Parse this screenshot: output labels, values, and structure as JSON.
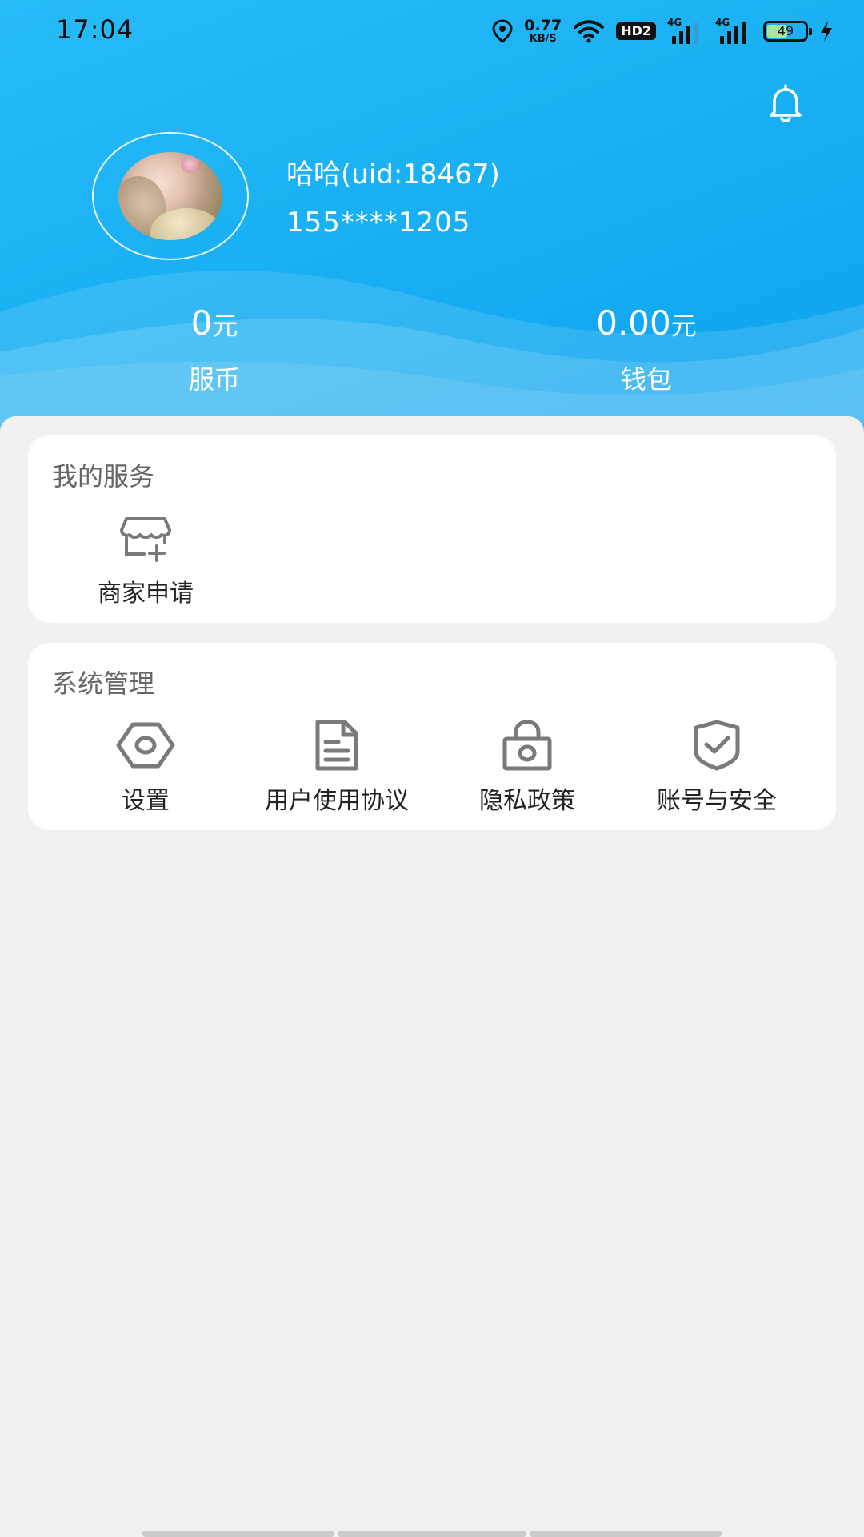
{
  "status_bar": {
    "time": "17:04",
    "net_speed_value": "0.77",
    "net_speed_unit": "KB/S",
    "hd_badge": "HD2",
    "signal_1_label": "4G",
    "signal_2_label": "4G",
    "battery_percent": "49",
    "icons": [
      "location-icon",
      "wifi-icon",
      "hd-icon",
      "signal-icon",
      "signal-icon",
      "battery-icon",
      "charging-icon"
    ]
  },
  "header": {
    "bell_icon": "bell-icon",
    "user": {
      "name": "哈哈(uid:18467)",
      "phone": "155****1205"
    },
    "stats": [
      {
        "value": "0",
        "unit": "元",
        "label": "服币"
      },
      {
        "value": "0.00",
        "unit": "元",
        "label": "钱包"
      }
    ]
  },
  "services": {
    "title": "我的服务",
    "items": [
      {
        "label": "商家申请",
        "icon": "store-add-icon"
      }
    ]
  },
  "system": {
    "title": "系统管理",
    "items": [
      {
        "label": "设置",
        "icon": "settings-hex-icon"
      },
      {
        "label": "用户使用协议",
        "icon": "document-icon"
      },
      {
        "label": "隐私政策",
        "icon": "lock-icon"
      },
      {
        "label": "账号与安全",
        "icon": "shield-check-icon"
      }
    ]
  },
  "colors": {
    "header_gradient_start": "#27bcf8",
    "header_gradient_end": "#0ea3ee",
    "page_background": "#f1f1f1",
    "card_background": "#ffffff",
    "icon_gray": "#7a7a7a"
  }
}
